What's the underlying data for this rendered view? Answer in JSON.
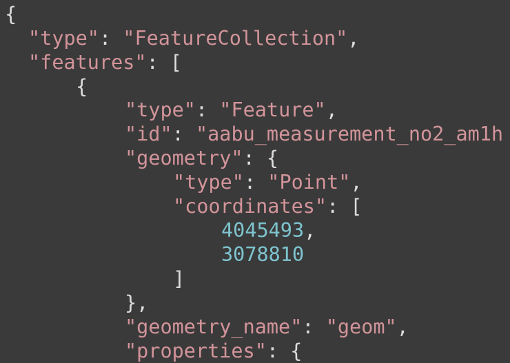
{
  "code": {
    "lines": [
      {
        "brace": "{"
      },
      {
        "key": "\"type\"",
        "sep": ": ",
        "value": "\"FeatureCollection\"",
        "trail": ","
      },
      {
        "key": "\"features\"",
        "sep": ": ",
        "open": "["
      },
      {
        "brace": "{"
      },
      {
        "key": "\"type\"",
        "sep": ": ",
        "value": "\"Feature\"",
        "trail": ","
      },
      {
        "key": "\"id\"",
        "sep": ": ",
        "value": "\"aabu_measurement_no2_am1h"
      },
      {
        "key": "\"geometry\"",
        "sep": ": ",
        "open": "{"
      },
      {
        "key": "\"type\"",
        "sep": ": ",
        "value": "\"Point\"",
        "trail": ","
      },
      {
        "key": "\"coordinates\"",
        "sep": ": ",
        "open": "["
      },
      {
        "number": "4045493",
        "trail": ","
      },
      {
        "number": "3078810"
      },
      {
        "brace": "]"
      },
      {
        "brace": "}",
        "trail": ","
      },
      {
        "key": "\"geometry_name\"",
        "sep": ": ",
        "value": "\"geom\"",
        "trail": ","
      },
      {
        "key": "\"properties\"",
        "sep": ": ",
        "open": "{"
      }
    ]
  },
  "colors": {
    "background": "#3a3a3a",
    "key": "#d2949a",
    "string": "#d2949a",
    "number": "#7ec4cf",
    "punctuation": "#dcdcdc"
  }
}
